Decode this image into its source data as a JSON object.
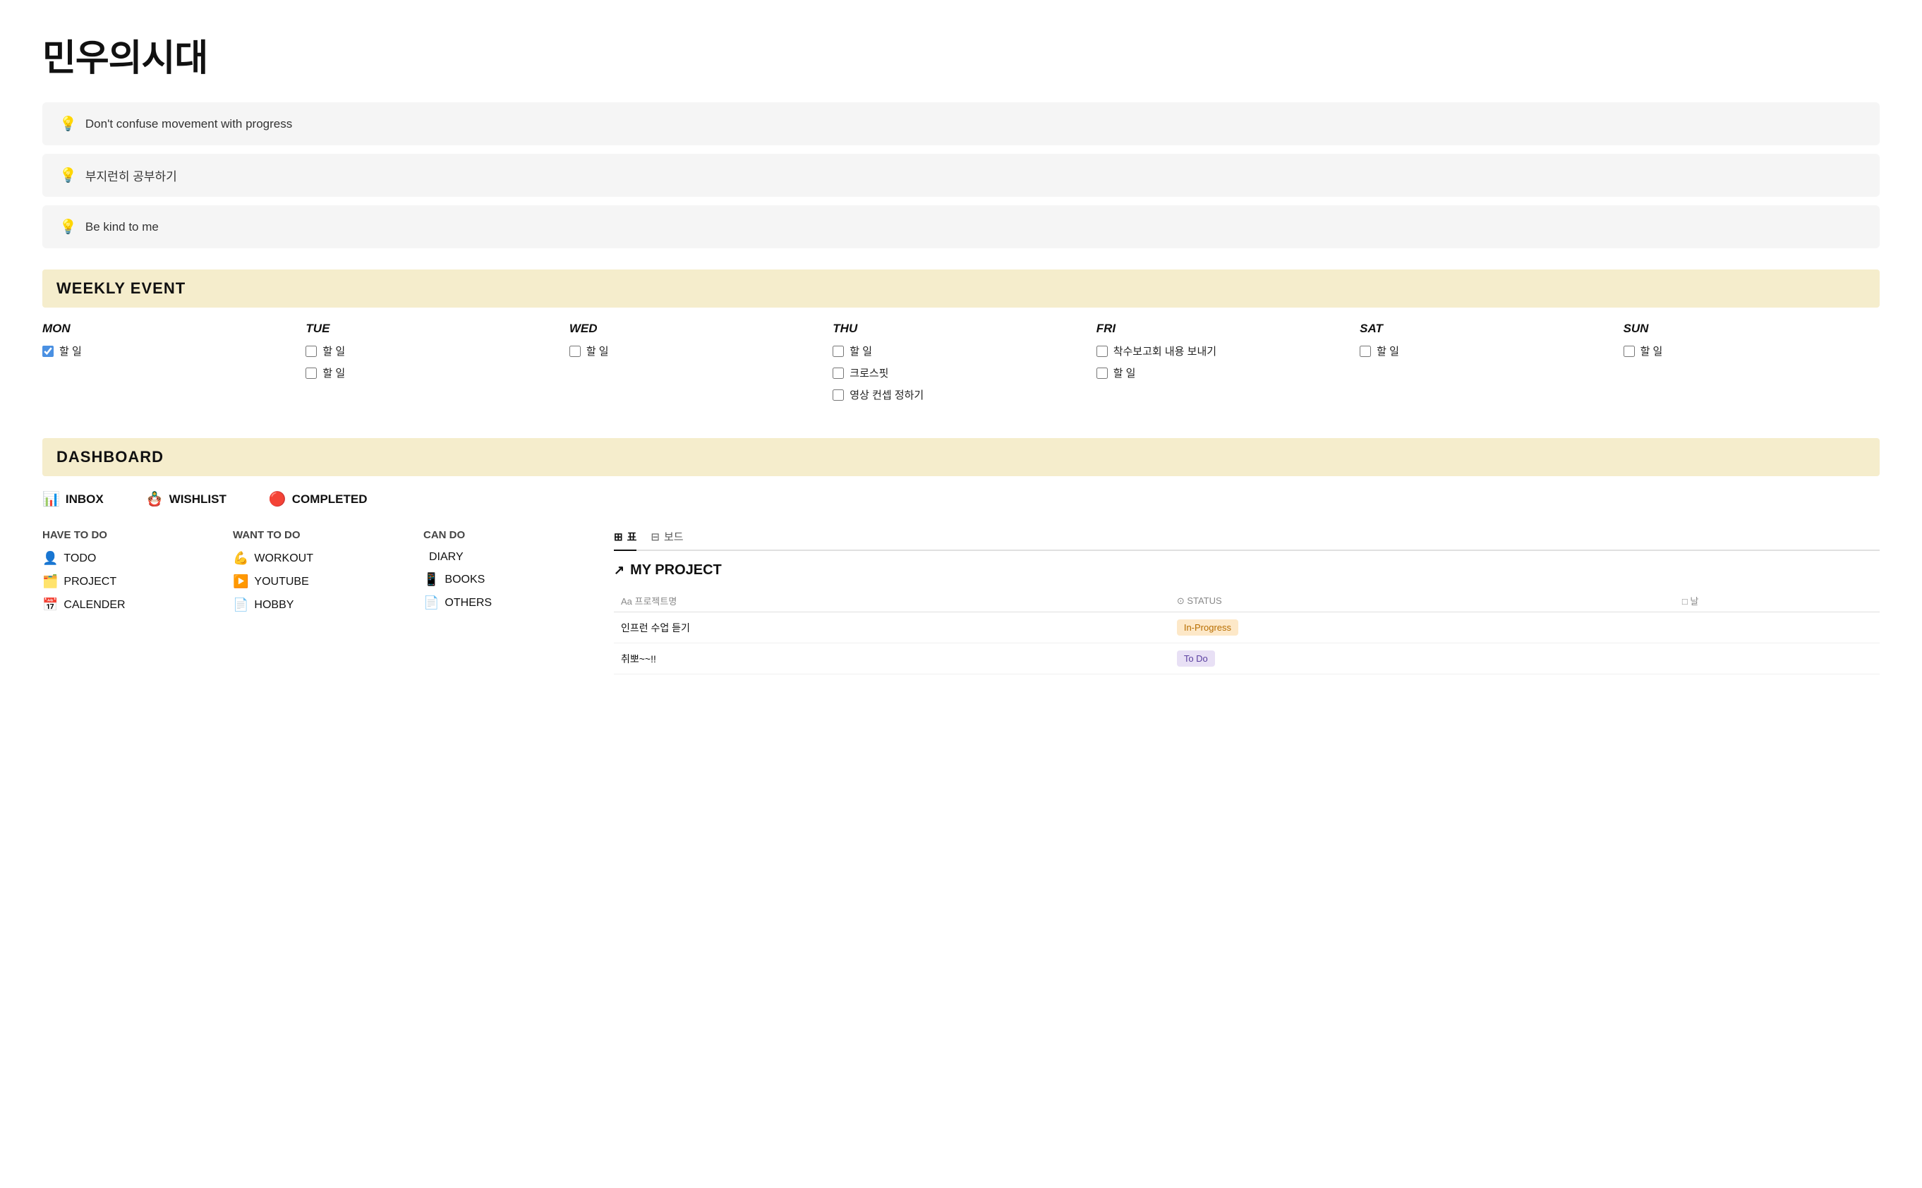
{
  "page": {
    "title": "민우의시대"
  },
  "quotes": [
    {
      "icon": "💡",
      "text": "Don't confuse movement with progress"
    },
    {
      "icon": "💡",
      "text": "부지런히 공부하기"
    },
    {
      "icon": "💡",
      "text": "Be kind to me"
    }
  ],
  "weekly_event": {
    "label": "WEEKLY EVENT",
    "days": [
      {
        "label": "MON",
        "tasks": [
          {
            "text": "할 일",
            "checked": true
          }
        ]
      },
      {
        "label": "TUE",
        "tasks": [
          {
            "text": "할 일",
            "checked": false
          },
          {
            "text": "할 일",
            "checked": false
          }
        ]
      },
      {
        "label": "WED",
        "tasks": [
          {
            "text": "할 일",
            "checked": false
          }
        ]
      },
      {
        "label": "THU",
        "tasks": [
          {
            "text": "할 일",
            "checked": false
          },
          {
            "text": "크로스핏",
            "checked": false
          },
          {
            "text": "영상 컨셉 정하기",
            "checked": false
          }
        ]
      },
      {
        "label": "FRI",
        "tasks": [
          {
            "text": "착수보고회 내용 보내기",
            "checked": false
          },
          {
            "text": "할 일",
            "checked": false
          }
        ]
      },
      {
        "label": "SAT",
        "tasks": [
          {
            "text": "할 일",
            "checked": false
          }
        ]
      },
      {
        "label": "SUN",
        "tasks": [
          {
            "text": "할 일",
            "checked": false
          }
        ]
      }
    ]
  },
  "dashboard": {
    "label": "DASHBOARD",
    "top_links": [
      {
        "icon": "📊",
        "label": "INBOX"
      },
      {
        "icon": "🪆",
        "label": "WISHLIST"
      },
      {
        "icon": "🔴",
        "label": "COMPLETED"
      }
    ],
    "columns": [
      {
        "title": "HAVE TO DO",
        "items": [
          {
            "icon": "👤",
            "label": "TODO"
          },
          {
            "icon": "🗂️",
            "label": "PROJECT"
          },
          {
            "icon": "📅",
            "label": "CALENDER"
          }
        ]
      },
      {
        "title": "WANT TO DO",
        "items": [
          {
            "icon": "💪",
            "label": "WORKOUT"
          },
          {
            "icon": "▶️",
            "label": "YOUTUBE"
          },
          {
            "icon": "📄",
            "label": "HOBBY"
          }
        ]
      },
      {
        "title": "CAN DO",
        "items": [
          {
            "icon": "",
            "label": "DIARY"
          },
          {
            "icon": "📱",
            "label": "BOOKS"
          },
          {
            "icon": "📄",
            "label": "OTHERS"
          }
        ]
      }
    ],
    "project": {
      "tabs": [
        {
          "icon": "⊞",
          "label": "표",
          "active": true
        },
        {
          "icon": "⊟",
          "label": "보드",
          "active": false
        }
      ],
      "title": "MY PROJECT",
      "columns": [
        {
          "label": "Aa 프로젝트명"
        },
        {
          "label": "⊙ STATUS"
        },
        {
          "label": "□ 날"
        }
      ],
      "rows": [
        {
          "name": "인프런 수업 듣기",
          "status": "In-Progress",
          "status_class": "status-inprogress",
          "date": ""
        },
        {
          "name": "취뽀~~!!",
          "status": "To Do",
          "status_class": "status-todo",
          "date": ""
        }
      ]
    }
  }
}
